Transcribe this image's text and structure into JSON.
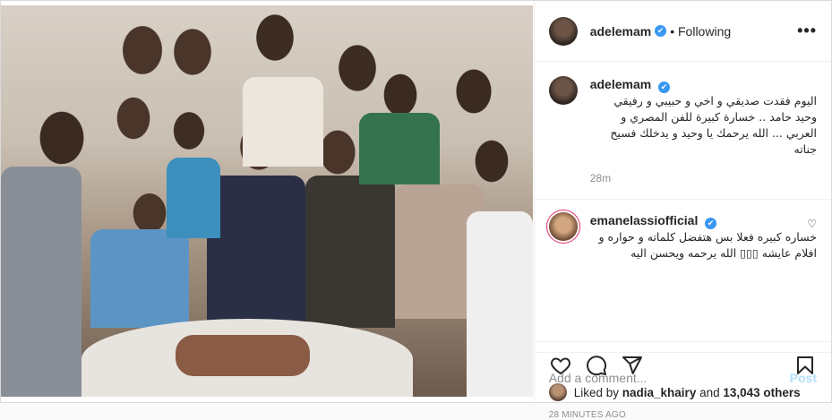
{
  "post": {
    "author": "adelemam",
    "follow_status": "Following",
    "more_glyph": "•••",
    "verified_glyph": "✔",
    "colors": {
      "accent": "#3897f0",
      "post_button": "#b2dffc",
      "muted": "#8e8e8e"
    }
  },
  "caption": {
    "username": "adelemam",
    "text": "اليوم فقدت صديقي و اخي و حبيبي و رفيقي وحيد حامد .. خسارة كبيرة للفن المصري و العربي ... الله يرحمك يا وحيد و يدخلك فسيح جناته",
    "time": "28m"
  },
  "comment": {
    "username": "emanelassiofficial",
    "text": "خساره كبيره فعلا بس هتفضل كلماته و حواره و افلام عايشه ▯▯▯ الله يرحمه ويحسن اليه"
  },
  "actions": {
    "icons": [
      "heart-icon",
      "comment-icon",
      "share-icon",
      "bookmark-icon"
    ]
  },
  "likes": {
    "prefix": "Liked by",
    "user": "nadia_khairy",
    "connector": "and",
    "others": "13,043 others"
  },
  "posted_ago": "28 MINUTES AGO",
  "add_comment": {
    "placeholder": "Add a comment...",
    "post_label": "Post"
  }
}
